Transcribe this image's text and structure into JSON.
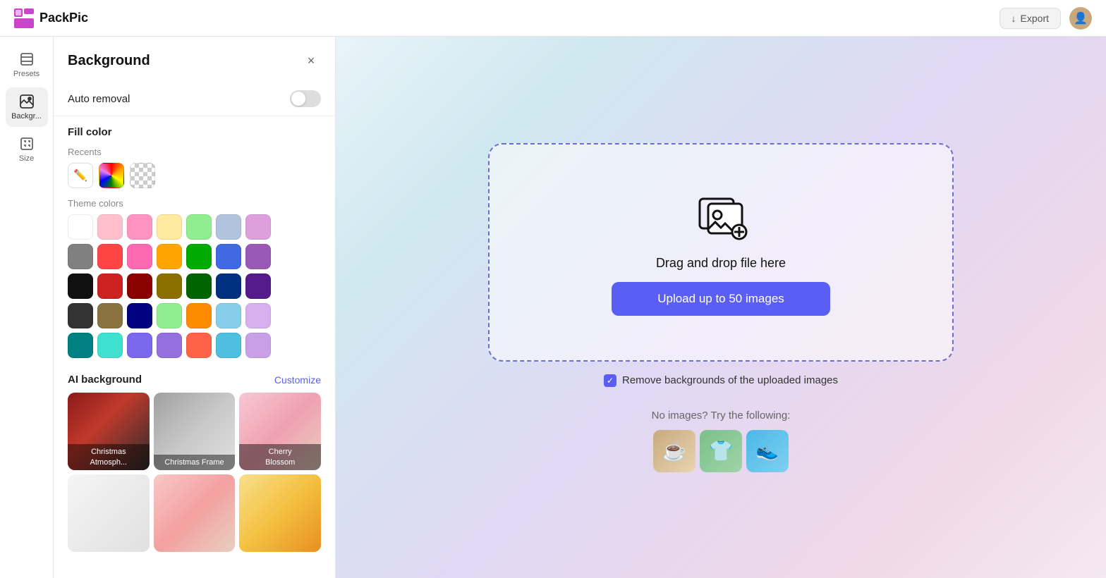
{
  "header": {
    "logo_text": "PackPic",
    "export_label": "Export"
  },
  "sidebar": {
    "items": [
      {
        "label": "Presets",
        "icon": "layers-icon"
      },
      {
        "label": "Backgr...",
        "icon": "background-icon",
        "active": true
      },
      {
        "label": "Size",
        "icon": "size-icon"
      }
    ]
  },
  "panel": {
    "title": "Background",
    "close_label": "×",
    "auto_removal": {
      "label": "Auto removal"
    },
    "fill_color": {
      "label": "Fill color",
      "recents_label": "Recents",
      "theme_colors_label": "Theme colors"
    },
    "ai_background": {
      "label": "AI background",
      "customize_label": "Customize",
      "items": [
        {
          "label": "Christmas\nAtmosph...",
          "style": "christmas-atmo"
        },
        {
          "label": "Christmas\nFrame",
          "style": "christmas-frame"
        },
        {
          "label": "Cherry\nBlossom",
          "style": "cherry-blossom"
        },
        {
          "label": "",
          "style": "row2-1"
        },
        {
          "label": "",
          "style": "row2-2"
        },
        {
          "label": "",
          "style": "row2-3"
        }
      ]
    }
  },
  "canvas": {
    "drag_drop_text": "Drag and drop file here",
    "upload_button_label": "Upload up to 50 images",
    "remove_bg_label": "Remove backgrounds of the uploaded images",
    "no_images_text": "No images? Try the following:",
    "sample_images": [
      {
        "label": "coffee",
        "emoji": "☕"
      },
      {
        "label": "shirt",
        "emoji": "👕"
      },
      {
        "label": "shoe",
        "emoji": "👟"
      }
    ]
  },
  "colors": {
    "theme": [
      "#ffffff",
      "#ffc0cb",
      "#ff94c2",
      "#ffeaa0",
      "#90ee90",
      "#b0c4de",
      "#dda0dd",
      "#808080",
      "#ff4444",
      "#ff69b4",
      "#ffa500",
      "#00aa00",
      "#4169e1",
      "#9b59b6",
      "#111111",
      "#cc2222",
      "#8b0000",
      "#8b7000",
      "#006400",
      "#003080",
      "#551a8b",
      "#333333",
      "#8b7340",
      "#000080",
      "#90ee90",
      "#ff8c00",
      "#87ceeb",
      "#d8b0f0",
      "#008080",
      "#40e0d0",
      "#7b68ee",
      "#9370db",
      "#ff6347",
      "#4fbfdf",
      "#c8a0e8"
    ]
  }
}
